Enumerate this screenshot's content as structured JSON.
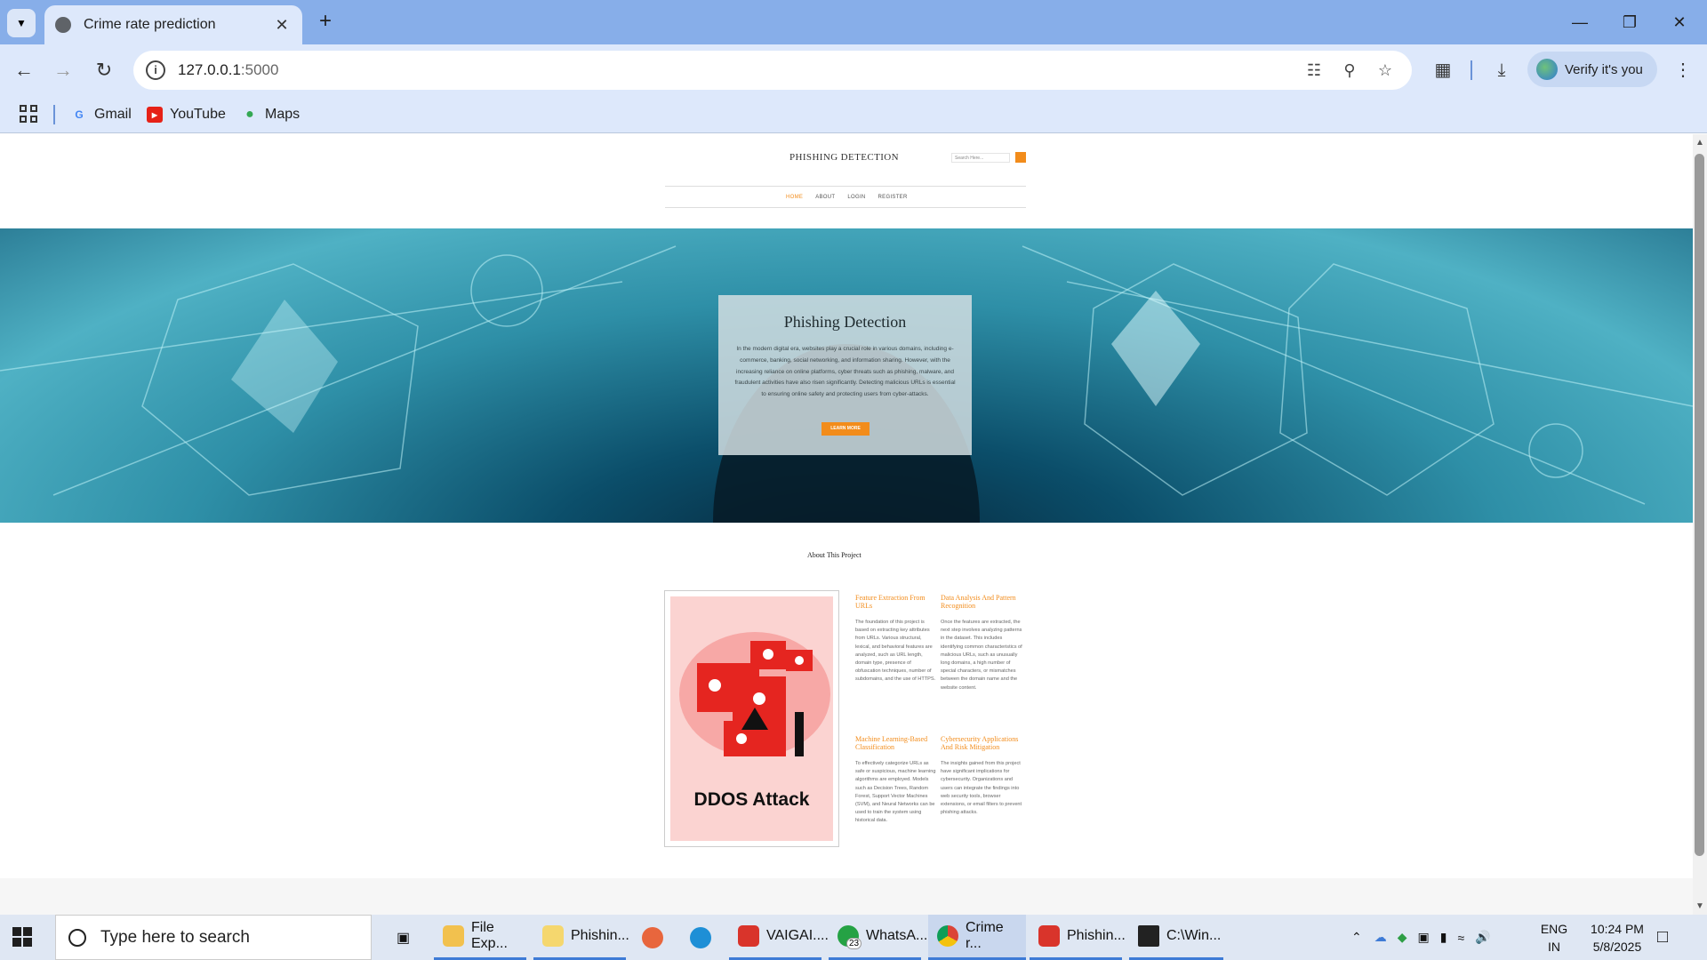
{
  "browser": {
    "tab_title": "Crime rate prediction",
    "url_host": "127.0.0.1",
    "url_port": ":5000",
    "verify_label": "Verify it's you",
    "bookmarks": [
      {
        "label": "Gmail"
      },
      {
        "label": "YouTube"
      },
      {
        "label": "Maps"
      }
    ]
  },
  "site": {
    "brand": "PHISHING DETECTION",
    "search_placeholder": "Search Here...",
    "nav": [
      "HOME",
      "ABOUT",
      "LOGIN",
      "REGISTER"
    ],
    "hero": {
      "title": "Phishing Detection",
      "text": "In the modern digital era, websites play a crucial role in various domains, including e-commerce, banking, social networking, and information sharing. However, with the increasing reliance on online platforms, cyber threats such as phishing, malware, and fraudulent activities have also risen significantly. Detecting malicious URLs is essential to ensuring online safety and protecting users from cyber-attacks.",
      "button": "LEARN MORE"
    },
    "about": {
      "title": "About This Project",
      "image_caption": "DDOS Attack",
      "features": [
        {
          "title": "Feature Extraction From URLs",
          "text": "The foundation of this project is based on extracting key attributes from URLs. Various structural, lexical, and behavioral features are analyzed, such as URL length, domain type, presence of obfuscation techniques, number of subdomains, and the use of HTTPS."
        },
        {
          "title": "Data Analysis And Pattern Recognition",
          "text": "Once the features are extracted, the next step involves analyzing patterns in the dataset. This includes identifying common characteristics of malicious URLs, such as unusually long domains, a high number of special characters, or mismatches between the domain name and the website content."
        },
        {
          "title": "Machine Learning-Based Classification",
          "text": "To effectively categorize URLs as safe or suspicious, machine learning algorithms are employed. Models such as Decision Trees, Random Forest, Support Vector Machines (SVM), and Neural Networks can be used to train the system using historical data."
        },
        {
          "title": "Cybersecurity Applications And Risk Mitigation",
          "text": "The insights gained from this project have significant implications for cybersecurity. Organizations and users can integrate the findings into web security tools, browser extensions, or email filters to prevent phishing attacks."
        }
      ]
    }
  },
  "taskbar": {
    "search_placeholder": "Type here to search",
    "apps": [
      {
        "label": "File Exp...",
        "color": "#f2c14e"
      },
      {
        "label": "Phishin...",
        "color": "#f5d76e"
      },
      {
        "label": "",
        "color": "#e8663d"
      },
      {
        "label": "",
        "color": "#1e8fd6"
      },
      {
        "label": "VAIGAI....",
        "color": "#d9342b"
      },
      {
        "label": "WhatsA...",
        "color": "#25a244",
        "badge": "23"
      },
      {
        "label": "Crime r...",
        "color": "#3e7bd6"
      },
      {
        "label": "Phishin...",
        "color": "#d9342b"
      },
      {
        "label": "C:\\Win...",
        "color": "#222222"
      }
    ],
    "lang_top": "ENG",
    "lang_bottom": "IN",
    "time": "10:24 PM",
    "date": "5/8/2025"
  },
  "colors": {
    "accent": "#f28c1b",
    "chrome": "#dde8fb",
    "tabbar": "#87aee9"
  }
}
